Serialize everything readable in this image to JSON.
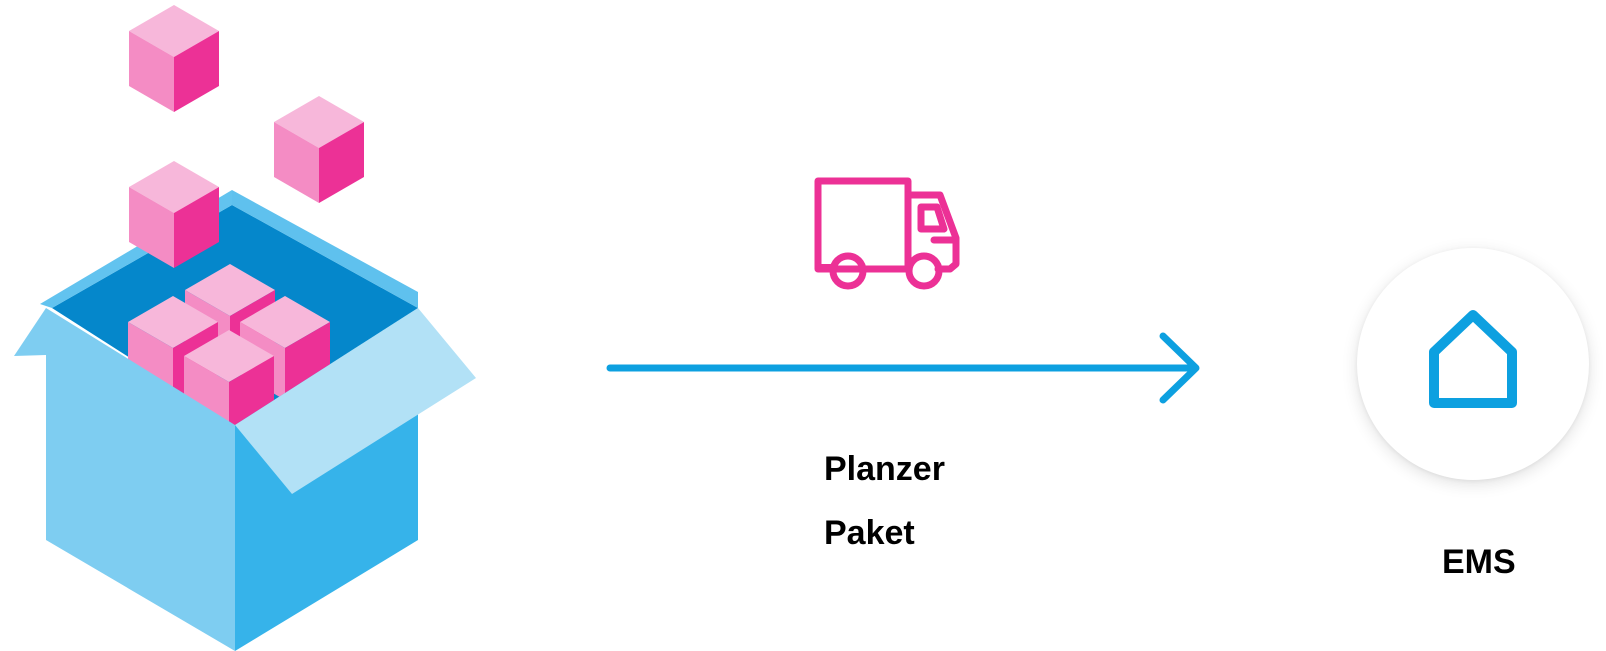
{
  "colors": {
    "brand_pink": "#EC3196",
    "brand_blue": "#0DA0E0",
    "box_blue_light": "#7ECDF1",
    "box_blue_mid": "#36B3EA",
    "box_blue_dark": "#0587CB",
    "cube_top": "#F7B7DA",
    "cube_left": "#F48CC4",
    "cube_right": "#EC3196"
  },
  "diagram": {
    "source_icon": "open-box-with-cubes-icon",
    "transport_icon": "delivery-truck-icon",
    "flow_icon": "right-arrow-icon",
    "target_icon": "home-icon",
    "transport_labels": [
      "Planzer",
      "Paket"
    ],
    "target_label": "EMS"
  }
}
